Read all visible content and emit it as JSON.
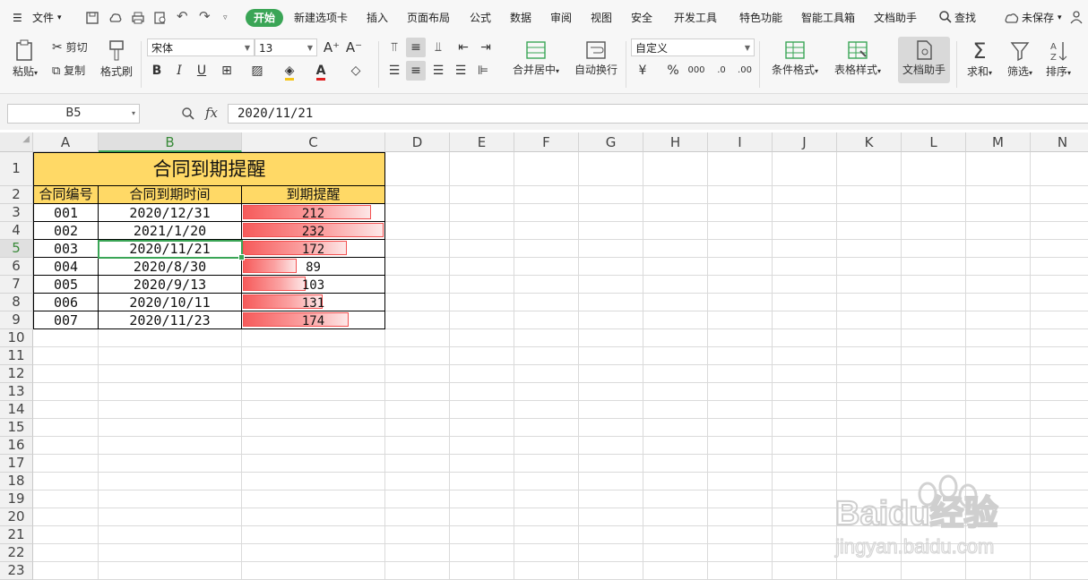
{
  "menu": {
    "file": "文件",
    "tabs": [
      "开始",
      "新建选项卡",
      "插入",
      "页面布局",
      "公式",
      "数据",
      "审阅",
      "视图",
      "安全",
      "开发工具",
      "特色功能",
      "智能工具箱",
      "文档助手"
    ],
    "search": "查找",
    "save_status": "未保存"
  },
  "ribbon": {
    "paste": "粘贴",
    "cut": "剪切",
    "copy": "复制",
    "format_painter": "格式刷",
    "font_name": "宋体",
    "font_size": "13",
    "number_format": "自定义",
    "merge_center": "合并居中",
    "wrap": "自动换行",
    "cond_format": "条件格式",
    "table_style": "表格样式",
    "doc_helper": "文档助手",
    "sum": "求和",
    "filter": "筛选",
    "sort": "排序"
  },
  "formula_bar": {
    "name_box": "B5",
    "fx": "fx",
    "content": "2020/11/21"
  },
  "columns": [
    "A",
    "B",
    "C",
    "D",
    "E",
    "F",
    "G",
    "H",
    "I",
    "J",
    "K",
    "L",
    "M",
    "N"
  ],
  "rows": [
    "1",
    "2",
    "3",
    "4",
    "5",
    "6",
    "7",
    "8",
    "9",
    "10",
    "11",
    "12",
    "13",
    "14",
    "15",
    "16",
    "17",
    "18",
    "19",
    "20",
    "21",
    "22",
    "23"
  ],
  "sheet": {
    "title": "合同到期提醒",
    "headers": [
      "合同编号",
      "合同到期时间",
      "到期提醒"
    ],
    "records": [
      {
        "id": "001",
        "date": "2020/12/31",
        "days": 212
      },
      {
        "id": "002",
        "date": "2021/1/20",
        "days": 232
      },
      {
        "id": "003",
        "date": "2020/11/21",
        "days": 172
      },
      {
        "id": "004",
        "date": "2020/8/30",
        "days": 89
      },
      {
        "id": "005",
        "date": "2020/9/13",
        "days": 103
      },
      {
        "id": "006",
        "date": "2020/10/11",
        "days": 131
      },
      {
        "id": "007",
        "date": "2020/11/23",
        "days": 174
      }
    ],
    "databar_max": 232
  },
  "watermark": {
    "brand": "Baidu经验",
    "url": "jingyan.baidu.com"
  },
  "colors": {
    "accent": "#3aa556",
    "header_fill": "#ffd966",
    "databar": "#f65b5b"
  }
}
